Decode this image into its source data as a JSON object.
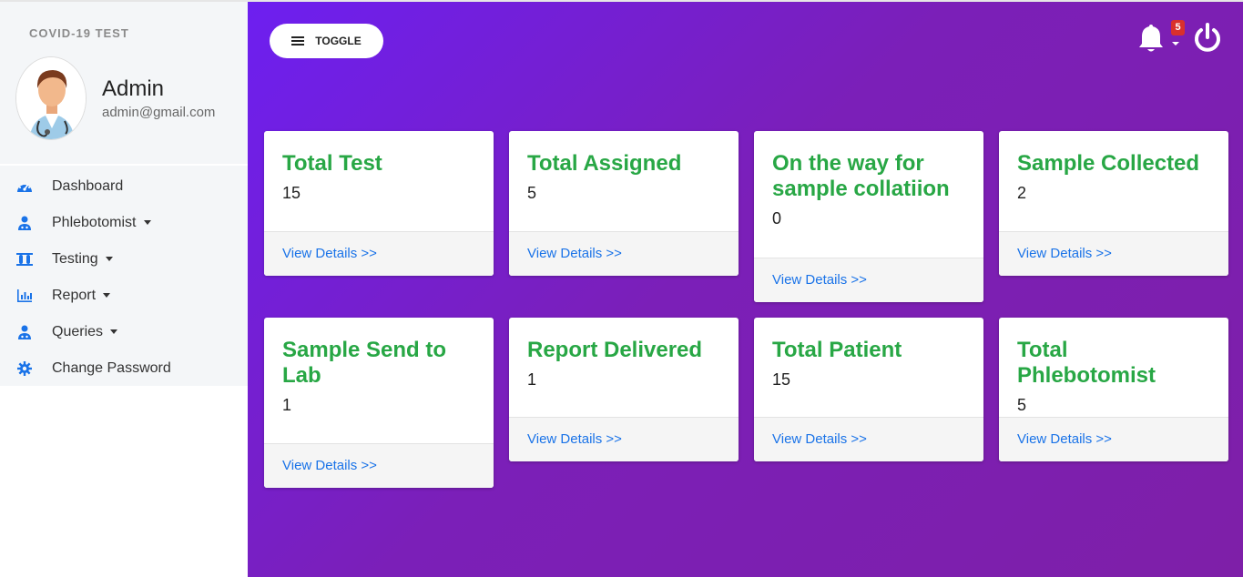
{
  "brand": "COVID-19 TEST",
  "profile": {
    "name": "Admin",
    "email": "admin@gmail.com"
  },
  "nav": [
    {
      "label": "Dashboard",
      "icon": "dashboard-icon",
      "dropdown": false
    },
    {
      "label": "Phlebotomist",
      "icon": "user-doctor-icon",
      "dropdown": true
    },
    {
      "label": "Testing",
      "icon": "test-tubes-icon",
      "dropdown": true
    },
    {
      "label": "Report",
      "icon": "bar-chart-icon",
      "dropdown": true
    },
    {
      "label": "Queries",
      "icon": "user-doctor-icon",
      "dropdown": true
    },
    {
      "label": "Change Password",
      "icon": "gear-icon",
      "dropdown": false
    }
  ],
  "header": {
    "toggle_label": "TOGGLE",
    "notification_count": "5"
  },
  "cards": [
    {
      "title": "Total Test",
      "value": "15",
      "link": "View Details >>"
    },
    {
      "title": "Total Assigned",
      "value": "5",
      "link": "View Details >>"
    },
    {
      "title": "On the way for sample collatiion",
      "value": "0",
      "link": "View Details >>"
    },
    {
      "title": "Sample Collected",
      "value": "2",
      "link": "View Details >>"
    },
    {
      "title": "Sample Send to Lab",
      "value": "1",
      "link": "View Details >>"
    },
    {
      "title": "Report Delivered",
      "value": "1",
      "link": "View Details >>"
    },
    {
      "title": "Total Patient",
      "value": "15",
      "link": "View Details >>"
    },
    {
      "title": "Total Phlebotomist",
      "value": "5",
      "link": "View Details >>"
    }
  ],
  "colors": {
    "accent": "#28a745",
    "link": "#1a73e8",
    "sidebar_icon": "#1a73e8",
    "badge": "#d9302c",
    "header_gradient_start": "#6d1ff0",
    "header_gradient_end": "#7e1fa8"
  }
}
